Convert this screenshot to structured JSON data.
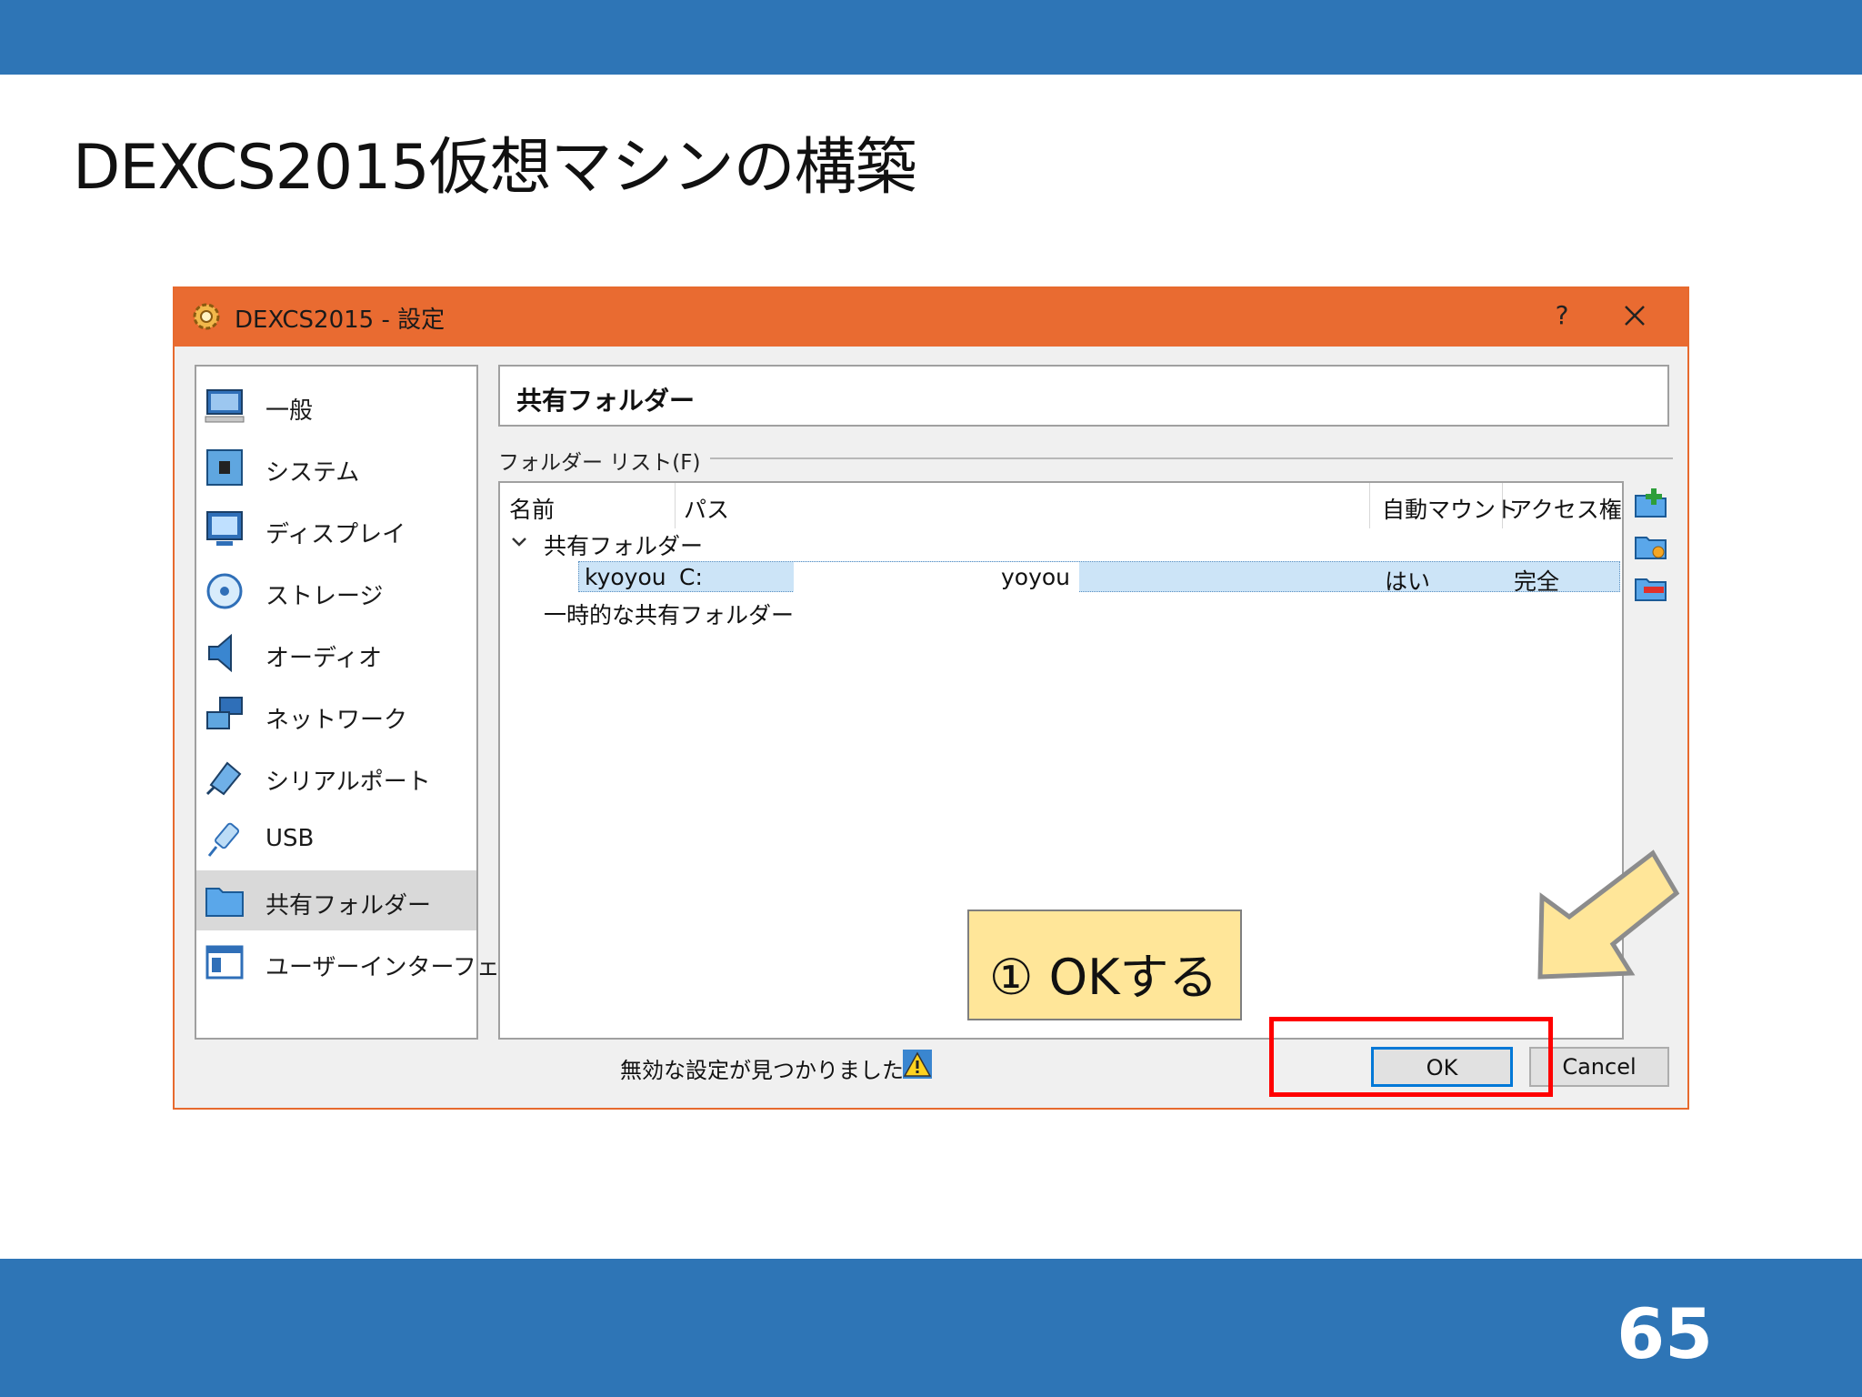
{
  "slide": {
    "title": "DEXCS2015仮想マシンの構築",
    "page_number": "65"
  },
  "dialog": {
    "title": "DEXCS2015 - 設定",
    "help": "?",
    "nav": [
      {
        "label": "一般",
        "icon": "monitor-icon"
      },
      {
        "label": "システム",
        "icon": "chip-icon"
      },
      {
        "label": "ディスプレイ",
        "icon": "display-icon"
      },
      {
        "label": "ストレージ",
        "icon": "disk-icon"
      },
      {
        "label": "オーディオ",
        "icon": "speaker-icon"
      },
      {
        "label": "ネットワーク",
        "icon": "network-icon"
      },
      {
        "label": "シリアルポート",
        "icon": "serial-port-icon"
      },
      {
        "label": "USB",
        "icon": "usb-icon"
      },
      {
        "label": "共有フォルダー",
        "icon": "folder-icon",
        "selected": true
      },
      {
        "label": "ユーザーインターフェース",
        "icon": "window-icon"
      }
    ],
    "section_title": "共有フォルダー",
    "group_label": "フォルダー リスト(F)",
    "columns": {
      "name": "名前",
      "path": "パス",
      "automount": "自動マウント",
      "access": "アクセス権"
    },
    "tree": {
      "group1": "共有フォルダー",
      "row": {
        "name": "kyoyou",
        "path_start": "C:",
        "path_end": "yoyou",
        "automount": "はい",
        "access": "完全"
      },
      "group2": "一時的な共有フォルダー"
    },
    "status": "無効な設定が見つかりました",
    "ok": "OK",
    "cancel": "Cancel"
  },
  "annotation": {
    "callout": "① OKする"
  },
  "colors": {
    "band": "#2e75b6",
    "titlebar": "#e96b31",
    "callout_fill": "#ffe699",
    "highlight": "#ff0000"
  }
}
